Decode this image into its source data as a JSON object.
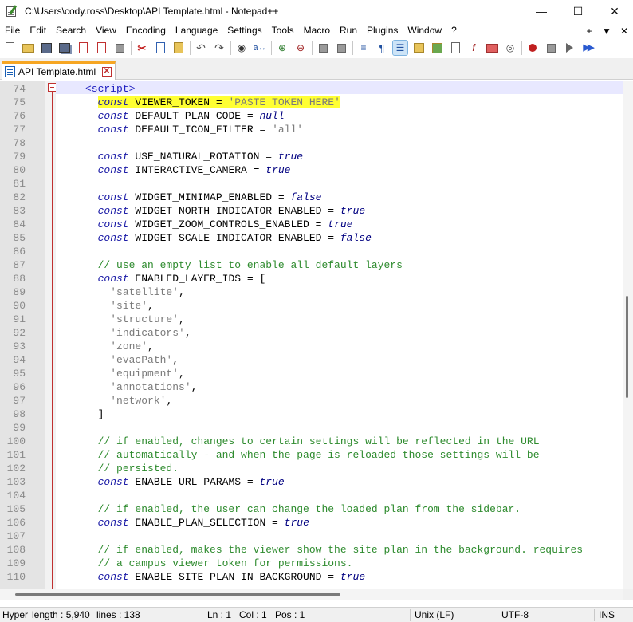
{
  "window": {
    "title": "C:\\Users\\cody.ross\\Desktop\\API Template.html - Notepad++",
    "minimize": "—",
    "maximize": "☐",
    "close": "✕"
  },
  "menu": {
    "items": [
      "File",
      "Edit",
      "Search",
      "View",
      "Encoding",
      "Language",
      "Settings",
      "Tools",
      "Macro",
      "Run",
      "Plugins",
      "Window",
      "?"
    ],
    "right": [
      "+",
      "▼",
      "✕"
    ]
  },
  "tab": {
    "label": "API Template.html",
    "close": "✕"
  },
  "editor": {
    "lines": [
      {
        "n": "74",
        "html": "<span class=\"tag\">&lt;script&gt;</span>"
      },
      {
        "n": "75",
        "html": "  <span class=\"hl\"><span class=\"kw\">const</span> VIEWER_TOKEN = <span class=\"str\">'PASTE TOKEN HERE'</span></span>"
      },
      {
        "n": "76",
        "html": "  <span class=\"kw\">const</span> DEFAULT_PLAN_CODE = <span class=\"kw2\">null</span>"
      },
      {
        "n": "77",
        "html": "  <span class=\"kw\">const</span> DEFAULT_ICON_FILTER = <span class=\"str\">'all'</span>"
      },
      {
        "n": "78",
        "html": ""
      },
      {
        "n": "79",
        "html": "  <span class=\"kw\">const</span> USE_NATURAL_ROTATION = <span class=\"kw2\">true</span>"
      },
      {
        "n": "80",
        "html": "  <span class=\"kw\">const</span> INTERACTIVE_CAMERA = <span class=\"kw2\">true</span>"
      },
      {
        "n": "81",
        "html": ""
      },
      {
        "n": "82",
        "html": "  <span class=\"kw\">const</span> WIDGET_MINIMAP_ENABLED = <span class=\"kw2\">false</span>"
      },
      {
        "n": "83",
        "html": "  <span class=\"kw\">const</span> WIDGET_NORTH_INDICATOR_ENABLED = <span class=\"kw2\">true</span>"
      },
      {
        "n": "84",
        "html": "  <span class=\"kw\">const</span> WIDGET_ZOOM_CONTROLS_ENABLED = <span class=\"kw2\">true</span>"
      },
      {
        "n": "85",
        "html": "  <span class=\"kw\">const</span> WIDGET_SCALE_INDICATOR_ENABLED = <span class=\"kw2\">false</span>"
      },
      {
        "n": "86",
        "html": ""
      },
      {
        "n": "87",
        "html": "  <span class=\"com\">// use an empty list to enable all default layers</span>"
      },
      {
        "n": "88",
        "html": "  <span class=\"kw\">const</span> ENABLED_LAYER_IDS = ["
      },
      {
        "n": "89",
        "html": "    <span class=\"str\">'satellite'</span>,"
      },
      {
        "n": "90",
        "html": "    <span class=\"str\">'site'</span>,"
      },
      {
        "n": "91",
        "html": "    <span class=\"str\">'structure'</span>,"
      },
      {
        "n": "92",
        "html": "    <span class=\"str\">'indicators'</span>,"
      },
      {
        "n": "93",
        "html": "    <span class=\"str\">'zone'</span>,"
      },
      {
        "n": "94",
        "html": "    <span class=\"str\">'evacPath'</span>,"
      },
      {
        "n": "95",
        "html": "    <span class=\"str\">'equipment'</span>,"
      },
      {
        "n": "96",
        "html": "    <span class=\"str\">'annotations'</span>,"
      },
      {
        "n": "97",
        "html": "    <span class=\"str\">'network'</span>,"
      },
      {
        "n": "98",
        "html": "  ]"
      },
      {
        "n": "99",
        "html": ""
      },
      {
        "n": "100",
        "html": "  <span class=\"com\">// if enabled, changes to certain settings will be reflected in the URL</span>"
      },
      {
        "n": "101",
        "html": "  <span class=\"com\">// automatically - and when the page is reloaded those settings will be</span>"
      },
      {
        "n": "102",
        "html": "  <span class=\"com\">// persisted.</span>"
      },
      {
        "n": "103",
        "html": "  <span class=\"kw\">const</span> ENABLE_URL_PARAMS = <span class=\"kw2\">true</span>"
      },
      {
        "n": "104",
        "html": ""
      },
      {
        "n": "105",
        "html": "  <span class=\"com\">// if enabled, the user can change the loaded plan from the sidebar.</span>"
      },
      {
        "n": "106",
        "html": "  <span class=\"kw\">const</span> ENABLE_PLAN_SELECTION = <span class=\"kw2\">true</span>"
      },
      {
        "n": "107",
        "html": ""
      },
      {
        "n": "108",
        "html": "  <span class=\"com\">// if enabled, makes the viewer show the site plan in the background. requires</span>"
      },
      {
        "n": "109",
        "html": "  <span class=\"com\">// a campus viewer token for permissions.</span>"
      },
      {
        "n": "110",
        "html": "  <span class=\"kw\">const</span> ENABLE_SITE_PLAN_IN_BACKGROUND = <span class=\"kw2\">true</span>"
      }
    ]
  },
  "status": {
    "type": "Hyper",
    "length": "length : 5,940",
    "lines": "lines : 138",
    "ln": "Ln : 1",
    "col": "Col : 1",
    "pos": "Pos : 1",
    "eol": "Unix (LF)",
    "encoding": "UTF-8",
    "mode": "INS"
  },
  "colors": {
    "tab_accent": "#f6a623",
    "highlight": "#ffff33",
    "keyword": "#1a1aa6",
    "comment": "#2e8b2e",
    "string": "#7a7a7a"
  }
}
